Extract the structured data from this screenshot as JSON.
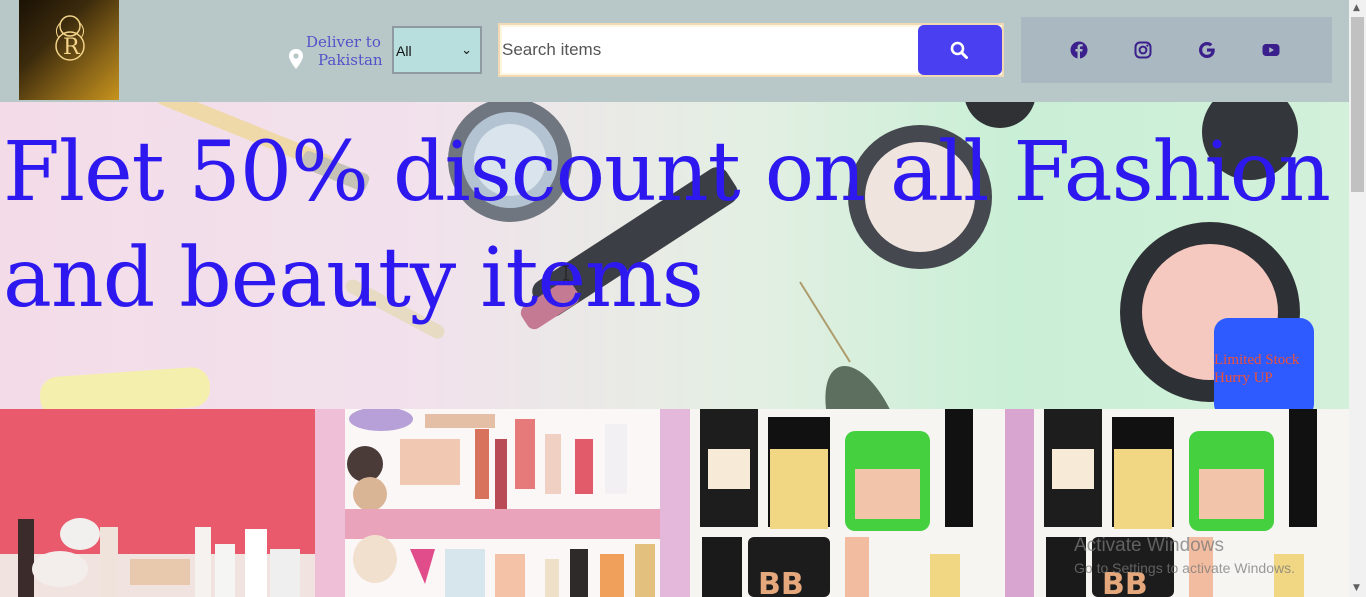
{
  "header": {
    "logo_icon": "brand-logo-R",
    "deliver": {
      "line1": "Deliver to",
      "line2": "Pakistan",
      "icon": "location-pin-icon"
    },
    "category_select": {
      "value": "All",
      "icon": "chevron-down-icon"
    },
    "search": {
      "placeholder": "Search items",
      "button_icon": "search-icon"
    },
    "social": [
      {
        "name": "facebook",
        "icon": "facebook-icon",
        "color": "#3b1f8c"
      },
      {
        "name": "instagram",
        "icon": "instagram-icon",
        "color": "#3b1f8c"
      },
      {
        "name": "google",
        "icon": "google-icon",
        "color": "#3b1f8c"
      },
      {
        "name": "youtube",
        "icon": "youtube-icon",
        "color": "#3b1f8c"
      }
    ]
  },
  "hero": {
    "headline": "Flet 50% discount on all Fashion and beauty items",
    "badge": {
      "line1": "Limited Stock",
      "line2": "Hurry UP"
    }
  },
  "products": [
    {
      "label": "makeup-collection-1"
    },
    {
      "label": "list-of-beauty-products"
    },
    {
      "label": "lady-fashion-cosmetics"
    },
    {
      "label": "lady-fashion-cosmetics-2"
    }
  ],
  "overlay": {
    "watermark_line1": "Activate Windows",
    "watermark_line2": "Go to Settings to activate Windows."
  },
  "colors": {
    "header_bg": "#b8c8c9",
    "accent": "#4a40f1",
    "headline": "#2d18f0",
    "badge_bg": "#2e5bff",
    "badge_text": "#f05036"
  }
}
